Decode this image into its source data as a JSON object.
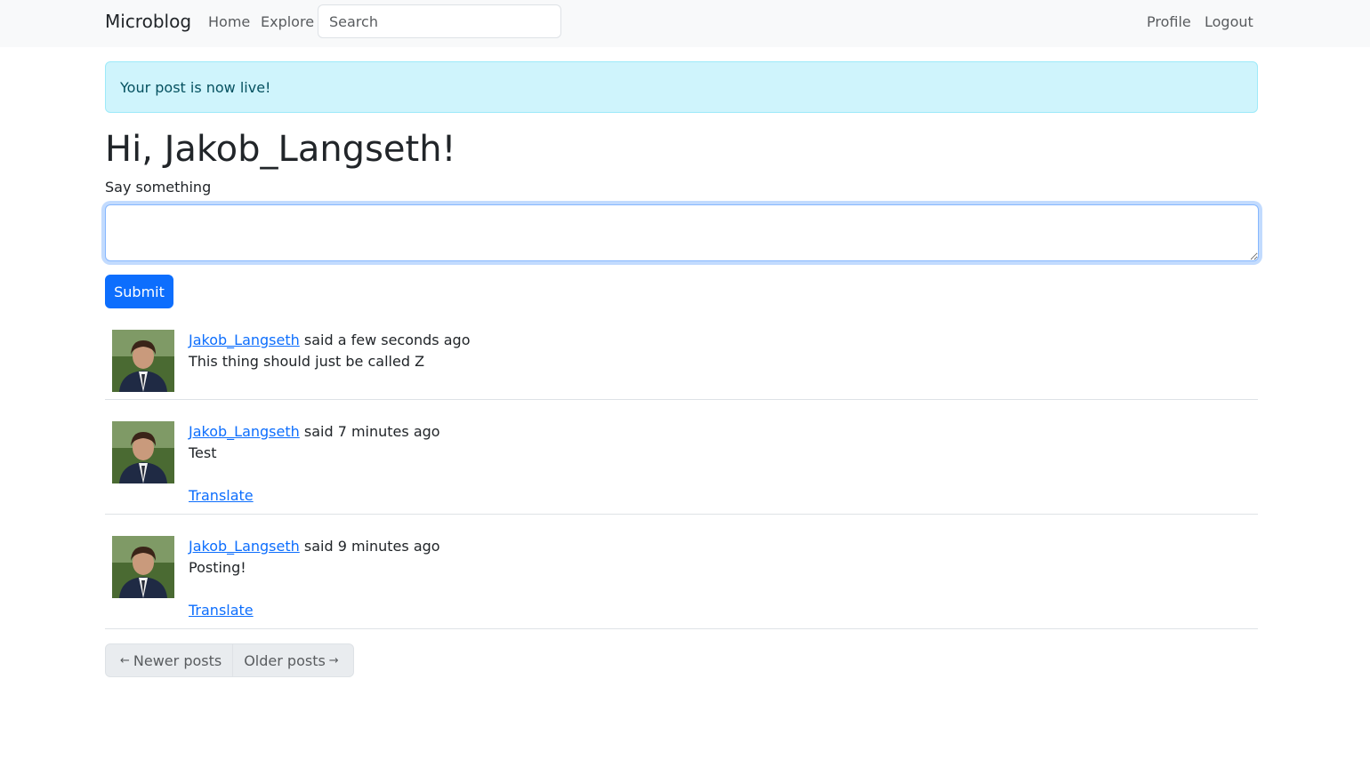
{
  "nav": {
    "brand": "Microblog",
    "home": "Home",
    "explore": "Explore",
    "search_placeholder": "Search",
    "profile": "Profile",
    "logout": "Logout"
  },
  "alert": {
    "message": "Your post is now live!"
  },
  "greeting": "Hi, Jakob_Langseth!",
  "form": {
    "label": "Say something",
    "value": "",
    "submit": "Submit"
  },
  "posts": [
    {
      "author": "Jakob_Langseth",
      "said": "said a few seconds ago",
      "body": "This thing should just be called Z",
      "translate": ""
    },
    {
      "author": "Jakob_Langseth",
      "said": "said 7 minutes ago",
      "body": "Test",
      "translate": "Translate"
    },
    {
      "author": "Jakob_Langseth",
      "said": "said 9 minutes ago",
      "body": "Posting!",
      "translate": "Translate"
    }
  ],
  "pagination": {
    "newer_arrow": "←",
    "newer": "Newer posts",
    "older": "Older posts",
    "older_arrow": "→"
  },
  "colors": {
    "primary": "#0d6efd",
    "alert_bg": "#cff4fc",
    "alert_text": "#055160",
    "navbar_bg": "#f8f9fa"
  }
}
